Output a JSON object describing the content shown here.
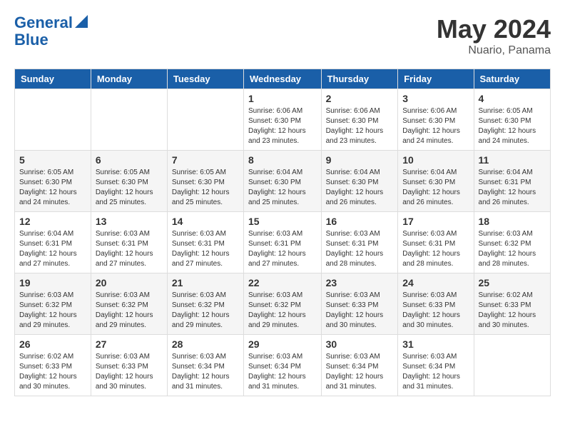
{
  "logo": {
    "line1": "General",
    "line2": "Blue"
  },
  "title": "May 2024",
  "location": "Nuario, Panama",
  "weekdays": [
    "Sunday",
    "Monday",
    "Tuesday",
    "Wednesday",
    "Thursday",
    "Friday",
    "Saturday"
  ],
  "weeks": [
    [
      {
        "day": "",
        "info": ""
      },
      {
        "day": "",
        "info": ""
      },
      {
        "day": "",
        "info": ""
      },
      {
        "day": "1",
        "info": "Sunrise: 6:06 AM\nSunset: 6:30 PM\nDaylight: 12 hours\nand 23 minutes."
      },
      {
        "day": "2",
        "info": "Sunrise: 6:06 AM\nSunset: 6:30 PM\nDaylight: 12 hours\nand 23 minutes."
      },
      {
        "day": "3",
        "info": "Sunrise: 6:06 AM\nSunset: 6:30 PM\nDaylight: 12 hours\nand 24 minutes."
      },
      {
        "day": "4",
        "info": "Sunrise: 6:05 AM\nSunset: 6:30 PM\nDaylight: 12 hours\nand 24 minutes."
      }
    ],
    [
      {
        "day": "5",
        "info": "Sunrise: 6:05 AM\nSunset: 6:30 PM\nDaylight: 12 hours\nand 24 minutes."
      },
      {
        "day": "6",
        "info": "Sunrise: 6:05 AM\nSunset: 6:30 PM\nDaylight: 12 hours\nand 25 minutes."
      },
      {
        "day": "7",
        "info": "Sunrise: 6:05 AM\nSunset: 6:30 PM\nDaylight: 12 hours\nand 25 minutes."
      },
      {
        "day": "8",
        "info": "Sunrise: 6:04 AM\nSunset: 6:30 PM\nDaylight: 12 hours\nand 25 minutes."
      },
      {
        "day": "9",
        "info": "Sunrise: 6:04 AM\nSunset: 6:30 PM\nDaylight: 12 hours\nand 26 minutes."
      },
      {
        "day": "10",
        "info": "Sunrise: 6:04 AM\nSunset: 6:30 PM\nDaylight: 12 hours\nand 26 minutes."
      },
      {
        "day": "11",
        "info": "Sunrise: 6:04 AM\nSunset: 6:31 PM\nDaylight: 12 hours\nand 26 minutes."
      }
    ],
    [
      {
        "day": "12",
        "info": "Sunrise: 6:04 AM\nSunset: 6:31 PM\nDaylight: 12 hours\nand 27 minutes."
      },
      {
        "day": "13",
        "info": "Sunrise: 6:03 AM\nSunset: 6:31 PM\nDaylight: 12 hours\nand 27 minutes."
      },
      {
        "day": "14",
        "info": "Sunrise: 6:03 AM\nSunset: 6:31 PM\nDaylight: 12 hours\nand 27 minutes."
      },
      {
        "day": "15",
        "info": "Sunrise: 6:03 AM\nSunset: 6:31 PM\nDaylight: 12 hours\nand 27 minutes."
      },
      {
        "day": "16",
        "info": "Sunrise: 6:03 AM\nSunset: 6:31 PM\nDaylight: 12 hours\nand 28 minutes."
      },
      {
        "day": "17",
        "info": "Sunrise: 6:03 AM\nSunset: 6:31 PM\nDaylight: 12 hours\nand 28 minutes."
      },
      {
        "day": "18",
        "info": "Sunrise: 6:03 AM\nSunset: 6:32 PM\nDaylight: 12 hours\nand 28 minutes."
      }
    ],
    [
      {
        "day": "19",
        "info": "Sunrise: 6:03 AM\nSunset: 6:32 PM\nDaylight: 12 hours\nand 29 minutes."
      },
      {
        "day": "20",
        "info": "Sunrise: 6:03 AM\nSunset: 6:32 PM\nDaylight: 12 hours\nand 29 minutes."
      },
      {
        "day": "21",
        "info": "Sunrise: 6:03 AM\nSunset: 6:32 PM\nDaylight: 12 hours\nand 29 minutes."
      },
      {
        "day": "22",
        "info": "Sunrise: 6:03 AM\nSunset: 6:32 PM\nDaylight: 12 hours\nand 29 minutes."
      },
      {
        "day": "23",
        "info": "Sunrise: 6:03 AM\nSunset: 6:33 PM\nDaylight: 12 hours\nand 30 minutes."
      },
      {
        "day": "24",
        "info": "Sunrise: 6:03 AM\nSunset: 6:33 PM\nDaylight: 12 hours\nand 30 minutes."
      },
      {
        "day": "25",
        "info": "Sunrise: 6:02 AM\nSunset: 6:33 PM\nDaylight: 12 hours\nand 30 minutes."
      }
    ],
    [
      {
        "day": "26",
        "info": "Sunrise: 6:02 AM\nSunset: 6:33 PM\nDaylight: 12 hours\nand 30 minutes."
      },
      {
        "day": "27",
        "info": "Sunrise: 6:03 AM\nSunset: 6:33 PM\nDaylight: 12 hours\nand 30 minutes."
      },
      {
        "day": "28",
        "info": "Sunrise: 6:03 AM\nSunset: 6:34 PM\nDaylight: 12 hours\nand 31 minutes."
      },
      {
        "day": "29",
        "info": "Sunrise: 6:03 AM\nSunset: 6:34 PM\nDaylight: 12 hours\nand 31 minutes."
      },
      {
        "day": "30",
        "info": "Sunrise: 6:03 AM\nSunset: 6:34 PM\nDaylight: 12 hours\nand 31 minutes."
      },
      {
        "day": "31",
        "info": "Sunrise: 6:03 AM\nSunset: 6:34 PM\nDaylight: 12 hours\nand 31 minutes."
      },
      {
        "day": "",
        "info": ""
      }
    ]
  ]
}
